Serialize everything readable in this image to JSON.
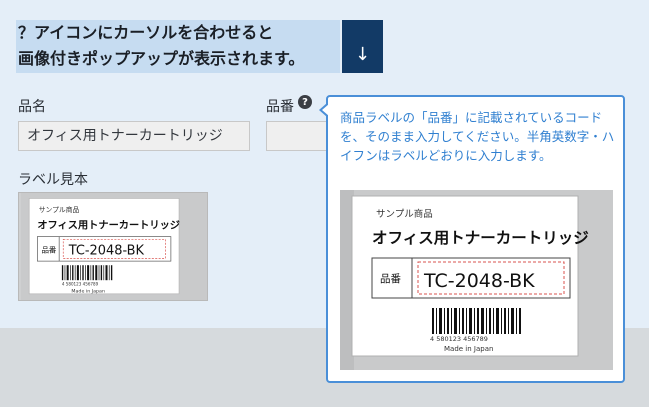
{
  "banner": {
    "line1": "？アイコンにカーソルを合わせると",
    "line2": "画像付きポップアップが表示されます。",
    "button_icon": "↓"
  },
  "form": {
    "product_name_label": "品名",
    "product_name_value": "オフィス用トナーカートリッジ",
    "product_number_label": "品番",
    "product_number_value": "",
    "help_icon": "?",
    "label_sample_title": "ラベル見本"
  },
  "tooltip": {
    "text": "商品ラベルの「品番」に記載されているコードを、そのまま入力してください。半角英数字・ハイフンはラベルどおりに入力します。"
  },
  "sample_label": {
    "header": "サンプル商品",
    "product": "オフィス用トナーカートリッジ",
    "field": "品番",
    "code": "TC-2048-BK",
    "barcode_digits": "4 580123 456789",
    "origin": "Made in Japan"
  },
  "colors": {
    "accent": "#123a66",
    "tooltip_border": "#4a8fd8",
    "tooltip_text": "#2f7fd0",
    "code_dash": "#d9534f"
  }
}
